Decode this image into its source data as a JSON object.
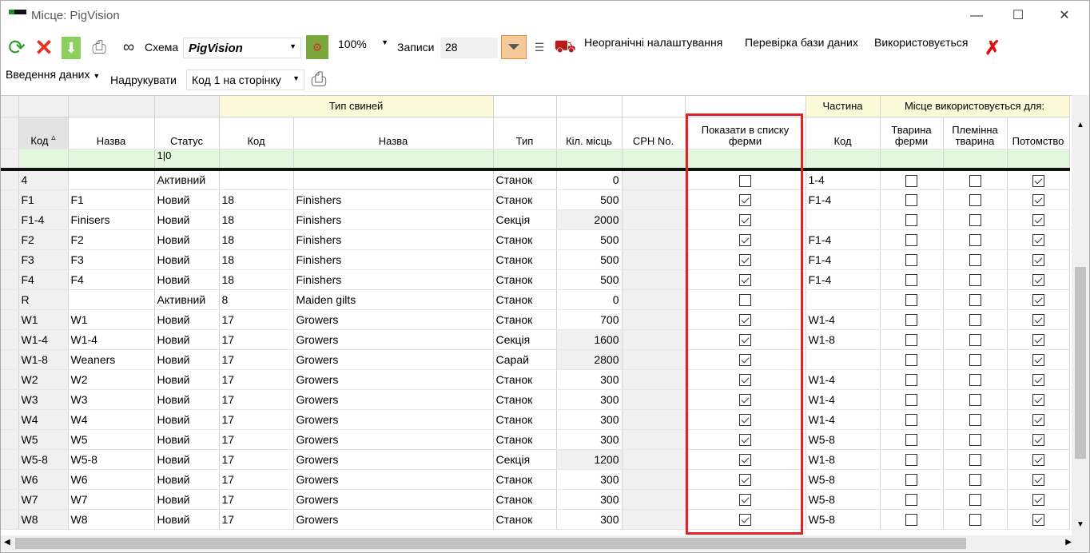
{
  "window": {
    "title": "Місце: PigVision",
    "min": "—",
    "max": "☐",
    "close": "✕"
  },
  "toolbar": {
    "schema_label": "Схема",
    "schema_value": "PigVision",
    "zoom_value": "100%",
    "records_label": "Записи",
    "records_value": "28",
    "inorganic_settings": "Неорганічні налаштування",
    "check_db": "Перевірка бази даних",
    "used": "Використовується",
    "data_entry": "Введення даних",
    "print_label": "Надрукувати",
    "print_option": "Код 1 на сторінку",
    "icons": [
      "refresh-icon",
      "delete-icon",
      "import-icon",
      "print-icon",
      "binoculars-icon",
      "schema-config-icon",
      "filter-icon",
      "tree-icon",
      "fire-truck-icon",
      "remove-used-icon",
      "printer-icon"
    ]
  },
  "grid": {
    "group_headers": {
      "pig_type": "Тип свиней",
      "part": "Частина",
      "used_for": "Місце використовується для:"
    },
    "columns": [
      "Код",
      "Назва",
      "Статус",
      "Код",
      "Назва",
      "Тип",
      "Кіл. місць",
      "CPH No.",
      "Показати в списку ферми",
      "Код",
      "Тварина ферми",
      "Племінна тварина",
      "Потомство"
    ],
    "sort_indicator": "▵",
    "filter_status": "1|0",
    "rows": [
      {
        "code": "4",
        "name": "",
        "status": "Активний",
        "pt_code": "",
        "pt_name": "",
        "type": "Станок",
        "places": "0",
        "cph": "",
        "show": false,
        "part": "1-4",
        "farm": false,
        "breed": false,
        "offspring": true
      },
      {
        "code": "F1",
        "name": "F1",
        "status": "Новий",
        "pt_code": "18",
        "pt_name": "Finishers",
        "type": "Станок",
        "places": "500",
        "cph": "",
        "show": true,
        "part": "F1-4",
        "farm": false,
        "breed": false,
        "offspring": true
      },
      {
        "code": "F1-4",
        "name": "Finisers",
        "status": "Новий",
        "pt_code": "18",
        "pt_name": "Finishers",
        "type": "Секція",
        "places": "2000",
        "cph": "",
        "show": true,
        "part": "",
        "farm": false,
        "breed": false,
        "offspring": true
      },
      {
        "code": "F2",
        "name": "F2",
        "status": "Новий",
        "pt_code": "18",
        "pt_name": "Finishers",
        "type": "Станок",
        "places": "500",
        "cph": "",
        "show": true,
        "part": "F1-4",
        "farm": false,
        "breed": false,
        "offspring": true
      },
      {
        "code": "F3",
        "name": "F3",
        "status": "Новий",
        "pt_code": "18",
        "pt_name": "Finishers",
        "type": "Станок",
        "places": "500",
        "cph": "",
        "show": true,
        "part": "F1-4",
        "farm": false,
        "breed": false,
        "offspring": true
      },
      {
        "code": "F4",
        "name": "F4",
        "status": "Новий",
        "pt_code": "18",
        "pt_name": "Finishers",
        "type": "Станок",
        "places": "500",
        "cph": "",
        "show": true,
        "part": "F1-4",
        "farm": false,
        "breed": false,
        "offspring": true
      },
      {
        "code": "R",
        "name": "",
        "status": "Активний",
        "pt_code": "8",
        "pt_name": "Maiden gilts",
        "type": "Станок",
        "places": "0",
        "cph": "",
        "show": false,
        "part": "",
        "farm": false,
        "breed": false,
        "offspring": true
      },
      {
        "code": "W1",
        "name": "W1",
        "status": "Новий",
        "pt_code": "17",
        "pt_name": "Growers",
        "type": "Станок",
        "places": "700",
        "cph": "",
        "show": true,
        "part": "W1-4",
        "farm": false,
        "breed": false,
        "offspring": true
      },
      {
        "code": "W1-4",
        "name": "W1-4",
        "status": "Новий",
        "pt_code": "17",
        "pt_name": "Growers",
        "type": "Секція",
        "places": "1600",
        "cph": "",
        "show": true,
        "part": "W1-8",
        "farm": false,
        "breed": false,
        "offspring": true
      },
      {
        "code": "W1-8",
        "name": "Weaners",
        "status": "Новий",
        "pt_code": "17",
        "pt_name": "Growers",
        "type": "Сарай",
        "places": "2800",
        "cph": "",
        "show": true,
        "part": "",
        "farm": false,
        "breed": false,
        "offspring": true
      },
      {
        "code": "W2",
        "name": "W2",
        "status": "Новий",
        "pt_code": "17",
        "pt_name": "Growers",
        "type": "Станок",
        "places": "300",
        "cph": "",
        "show": true,
        "part": "W1-4",
        "farm": false,
        "breed": false,
        "offspring": true
      },
      {
        "code": "W3",
        "name": "W3",
        "status": "Новий",
        "pt_code": "17",
        "pt_name": "Growers",
        "type": "Станок",
        "places": "300",
        "cph": "",
        "show": true,
        "part": "W1-4",
        "farm": false,
        "breed": false,
        "offspring": true
      },
      {
        "code": "W4",
        "name": "W4",
        "status": "Новий",
        "pt_code": "17",
        "pt_name": "Growers",
        "type": "Станок",
        "places": "300",
        "cph": "",
        "show": true,
        "part": "W1-4",
        "farm": false,
        "breed": false,
        "offspring": true
      },
      {
        "code": "W5",
        "name": "W5",
        "status": "Новий",
        "pt_code": "17",
        "pt_name": "Growers",
        "type": "Станок",
        "places": "300",
        "cph": "",
        "show": true,
        "part": "W5-8",
        "farm": false,
        "breed": false,
        "offspring": true
      },
      {
        "code": "W5-8",
        "name": "W5-8",
        "status": "Новий",
        "pt_code": "17",
        "pt_name": "Growers",
        "type": "Секція",
        "places": "1200",
        "cph": "",
        "show": true,
        "part": "W1-8",
        "farm": false,
        "breed": false,
        "offspring": true
      },
      {
        "code": "W6",
        "name": "W6",
        "status": "Новий",
        "pt_code": "17",
        "pt_name": "Growers",
        "type": "Станок",
        "places": "300",
        "cph": "",
        "show": true,
        "part": "W5-8",
        "farm": false,
        "breed": false,
        "offspring": true
      },
      {
        "code": "W7",
        "name": "W7",
        "status": "Новий",
        "pt_code": "17",
        "pt_name": "Growers",
        "type": "Станок",
        "places": "300",
        "cph": "",
        "show": true,
        "part": "W5-8",
        "farm": false,
        "breed": false,
        "offspring": true
      },
      {
        "code": "W8",
        "name": "W8",
        "status": "Новий",
        "pt_code": "17",
        "pt_name": "Growers",
        "type": "Станок",
        "places": "300",
        "cph": "",
        "show": true,
        "part": "W5-8",
        "farm": false,
        "breed": false,
        "offspring": true
      }
    ]
  },
  "highlight_color": "#e0202a"
}
